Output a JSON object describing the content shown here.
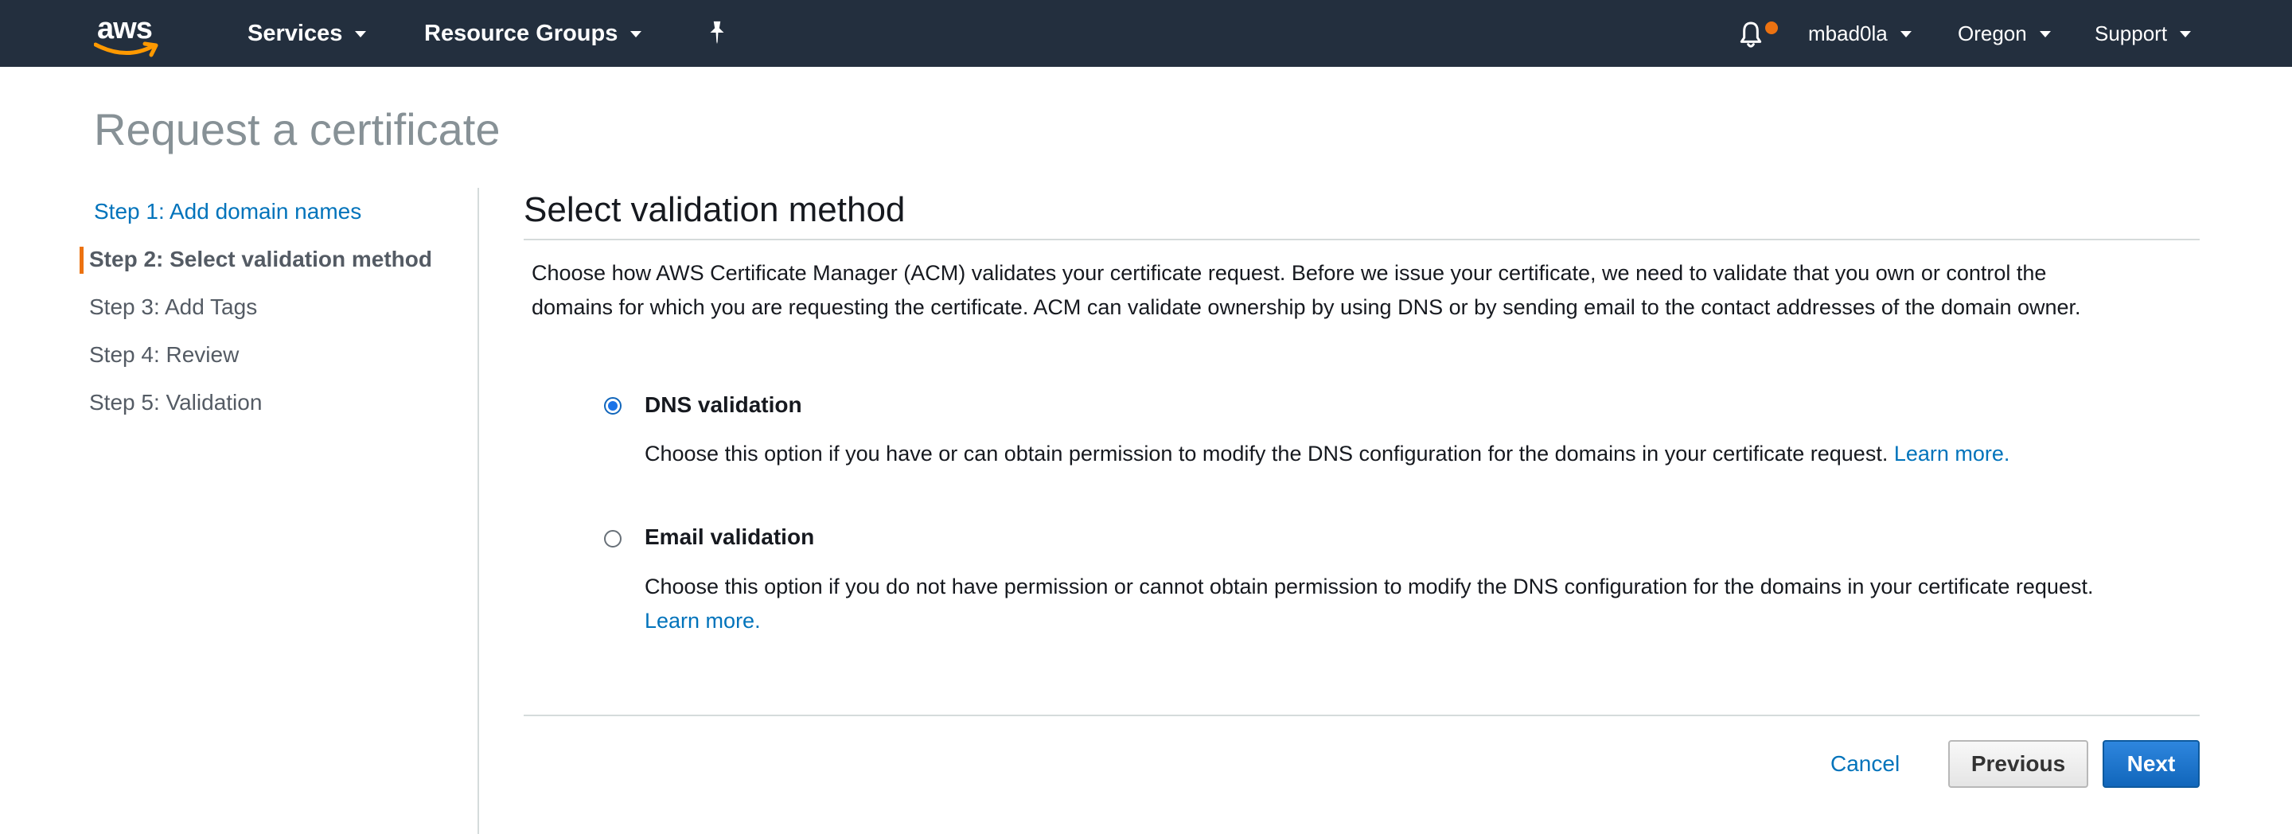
{
  "nav": {
    "logo_text": "aws",
    "services_label": "Services",
    "resource_groups_label": "Resource Groups",
    "user_label": "mbad0la",
    "region_label": "Oregon",
    "support_label": "Support",
    "pin_icon": "pin-icon",
    "bell_icon": "bell-icon",
    "notification_dot_color": "#ec7211"
  },
  "page": {
    "title": "Request a certificate"
  },
  "steps": [
    {
      "label": "Step 1: Add domain names",
      "state": "completed"
    },
    {
      "label": "Step 2: Select validation method",
      "state": "active"
    },
    {
      "label": "Step 3: Add Tags",
      "state": "upcoming"
    },
    {
      "label": "Step 4: Review",
      "state": "upcoming"
    },
    {
      "label": "Step 5: Validation",
      "state": "upcoming"
    }
  ],
  "content": {
    "section_title": "Select validation method",
    "intro_line1": "Choose how AWS Certificate Manager (ACM) validates your certificate request. Before we issue your certificate, we need to validate that you own or control the",
    "intro_line2": "domains for which you are requesting the certificate. ACM can validate ownership by using DNS or by sending email to the contact addresses of the domain owner.",
    "options": [
      {
        "label": "DNS validation",
        "selected": true,
        "description": "Choose this option if you have or can obtain permission to modify the DNS configuration for the domains in your certificate request.",
        "learn_more": "Learn more."
      },
      {
        "label": "Email validation",
        "selected": false,
        "description": "Choose this option if you do not have permission or cannot obtain permission to modify the DNS configuration for the domains in your certificate request.",
        "learn_more": "Learn more."
      }
    ]
  },
  "footer": {
    "cancel_label": "Cancel",
    "previous_label": "Previous",
    "next_label": "Next"
  },
  "colors": {
    "nav_background": "#232f3e",
    "link": "#0073bb",
    "active_step_marker": "#ec7211",
    "primary_button": "#1166bb"
  }
}
